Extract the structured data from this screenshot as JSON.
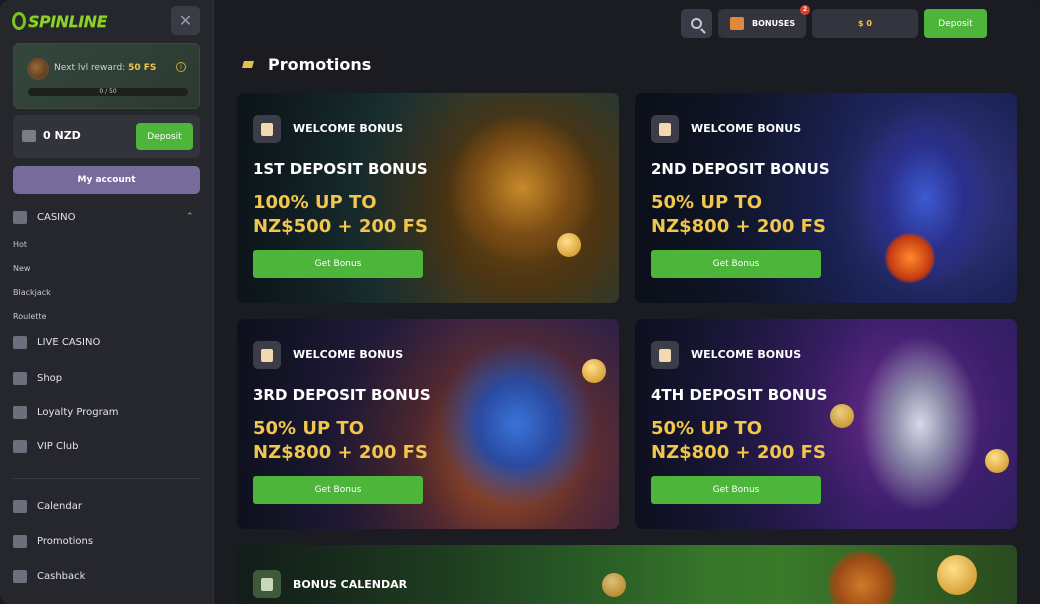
{
  "brand": {
    "logo_text": "SPINLINE"
  },
  "sidebar": {
    "reward": {
      "label": "Next lvl reward:",
      "value": "50 FS",
      "progress_text": "0 / 50",
      "progress": 0
    },
    "balance": {
      "amount": "0 NZD",
      "deposit_label": "Deposit"
    },
    "account_label": "My account",
    "casino": {
      "label": "CASINO",
      "items": [
        "Hot",
        "New",
        "Blackjack",
        "Roulette"
      ]
    },
    "nav": [
      {
        "label": "LIVE CASINO"
      },
      {
        "label": "Shop"
      },
      {
        "label": "Loyalty Program"
      },
      {
        "label": "VIP Club"
      }
    ],
    "nav2": [
      {
        "label": "Calendar"
      },
      {
        "label": "Promotions"
      },
      {
        "label": "Cashback"
      }
    ]
  },
  "topbar": {
    "bonuses_label": "BONUSES",
    "bonuses_badge": "2",
    "balance": "$ 0",
    "deposit_label": "Deposit"
  },
  "page": {
    "title": "Promotions"
  },
  "promos": [
    {
      "tag": "WELCOME BONUS",
      "name": "1ST DEPOSIT BONUS",
      "offer_line1": "100% UP TO",
      "offer_line2": "NZ$500 + 200 FS",
      "button": "Get Bonus"
    },
    {
      "tag": "WELCOME BONUS",
      "name": "2ND DEPOSIT BONUS",
      "offer_line1": "50% UP TO",
      "offer_line2": "NZ$800 + 200 FS",
      "button": "Get Bonus"
    },
    {
      "tag": "WELCOME BONUS",
      "name": "3RD DEPOSIT BONUS",
      "offer_line1": "50% UP TO",
      "offer_line2": "NZ$800 + 200 FS",
      "button": "Get Bonus"
    },
    {
      "tag": "WELCOME BONUS",
      "name": "4TH DEPOSIT BONUS",
      "offer_line1": "50% UP TO",
      "offer_line2": "NZ$800 + 200 FS",
      "button": "Get Bonus"
    },
    {
      "tag": "BONUS CALENDAR"
    }
  ],
  "colors": {
    "accent_green": "#4cb53a",
    "gold": "#f0c64d",
    "account_purple": "#776b9c"
  }
}
